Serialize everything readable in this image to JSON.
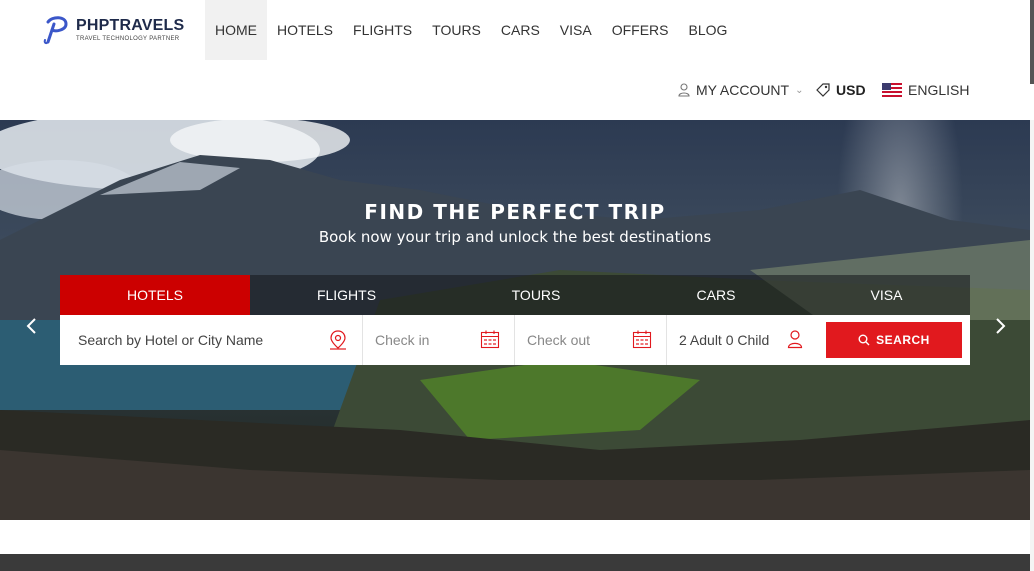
{
  "brand": {
    "name": "PHPTRAVELS",
    "tagline": "TRAVEL TECHNOLOGY PARTNER",
    "accent": "#1e2a4a"
  },
  "nav": {
    "items": [
      {
        "label": "HOME",
        "active": true
      },
      {
        "label": "HOTELS"
      },
      {
        "label": "FLIGHTS"
      },
      {
        "label": "TOURS"
      },
      {
        "label": "CARS"
      },
      {
        "label": "VISA"
      },
      {
        "label": "OFFERS"
      },
      {
        "label": "BLOG"
      }
    ]
  },
  "topbar": {
    "account": "MY ACCOUNT",
    "currency": "USD",
    "language": "ENGLISH",
    "icons": [
      "user-icon",
      "chevron-down-icon",
      "tag-icon",
      "us-flag-icon"
    ]
  },
  "hero": {
    "title": "FIND THE PERFECT TRIP",
    "subtitle": "Book now your trip and unlock the best destinations"
  },
  "tabs": [
    {
      "label": "HOTELS",
      "active": true
    },
    {
      "label": "FLIGHTS"
    },
    {
      "label": "TOURS"
    },
    {
      "label": "CARS"
    },
    {
      "label": "VISA"
    }
  ],
  "search": {
    "hotel_placeholder": "Search by Hotel or City Name",
    "checkin_placeholder": "Check in",
    "checkout_placeholder": "Check out",
    "guests_value": "2 Adult 0 Child",
    "button_label": "SEARCH",
    "accent": "#e1191e"
  },
  "colors": {
    "active_tab": "#cc0000",
    "search_button": "#e1191e"
  }
}
